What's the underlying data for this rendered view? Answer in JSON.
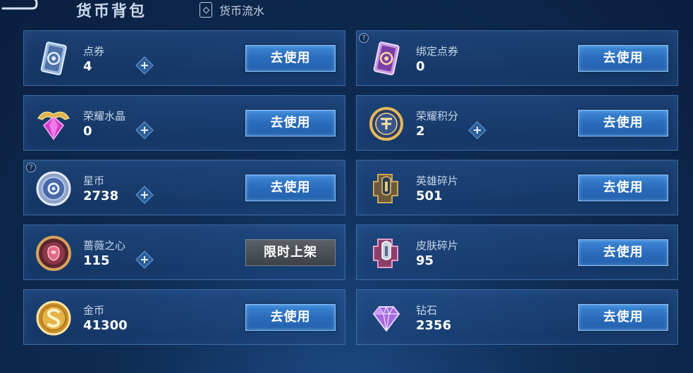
{
  "header": {
    "title": "货币背包",
    "flow_label": "货币流水"
  },
  "currencies": [
    {
      "name": "点券",
      "value": "4",
      "button": "去使用",
      "has_plus": true,
      "has_help": false,
      "icon": "coupon-card-icon"
    },
    {
      "name": "绑定点券",
      "value": "0",
      "button": "去使用",
      "has_plus": false,
      "has_help": true,
      "icon": "bound-coupon-card-icon"
    },
    {
      "name": "荣耀水晶",
      "value": "0",
      "button": "去使用",
      "has_plus": true,
      "has_help": false,
      "icon": "glory-crystal-icon"
    },
    {
      "name": "荣耀积分",
      "value": "2",
      "button": "去使用",
      "has_plus": true,
      "has_help": false,
      "icon": "glory-points-icon"
    },
    {
      "name": "星币",
      "value": "2738",
      "button": "去使用",
      "has_plus": true,
      "has_help": true,
      "icon": "star-coin-icon"
    },
    {
      "name": "英雄碎片",
      "value": "501",
      "button": "去使用",
      "has_plus": false,
      "has_help": false,
      "icon": "hero-fragment-icon"
    },
    {
      "name": "蔷薇之心",
      "value": "115",
      "button": "限时上架",
      "has_plus": true,
      "has_help": false,
      "icon": "rose-heart-icon"
    },
    {
      "name": "皮肤碎片",
      "value": "95",
      "button": "去使用",
      "has_plus": false,
      "has_help": false,
      "icon": "skin-fragment-icon"
    },
    {
      "name": "金币",
      "value": "41300",
      "button": "去使用",
      "has_plus": false,
      "has_help": false,
      "icon": "gold-coin-icon"
    },
    {
      "name": "钻石",
      "value": "2356",
      "button": "去使用",
      "has_plus": false,
      "has_help": false,
      "icon": "diamond-icon"
    }
  ],
  "help_mark": "?",
  "colors": {
    "accent": "#2a6cbc",
    "card_border": "#588ccd",
    "disabled_button": "#4a4f56"
  }
}
